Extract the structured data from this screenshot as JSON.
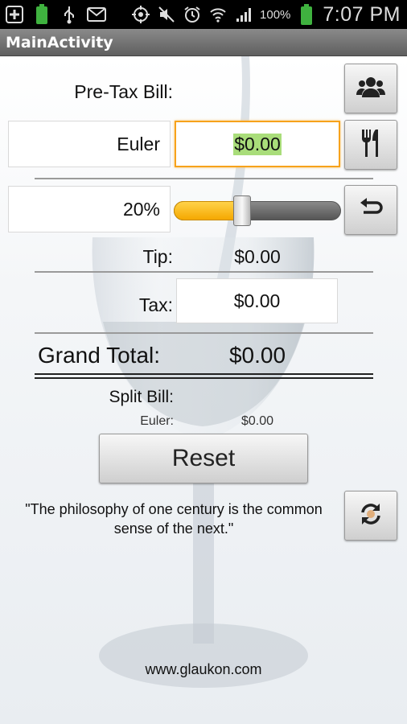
{
  "status_bar": {
    "battery": "100%",
    "time": "7:07 PM"
  },
  "title_bar": {
    "title": "MainActivity"
  },
  "form": {
    "pretax_label": "Pre-Tax Bill:",
    "person_name": "Euler",
    "pretax_value": "$0.00",
    "tip_percent_label": "20%",
    "tip_percent": 20,
    "tip_label": "Tip:",
    "tip_value": "$0.00",
    "tax_label": "Tax:",
    "tax_value": "$0.00",
    "grand_total_label": "Grand Total:",
    "grand_total_value": "$0.00",
    "split_label": "Split Bill:",
    "split_name": "Euler:",
    "split_value": "$0.00",
    "reset_label": "Reset"
  },
  "quote": "\"The philosophy of one century is the common sense of the next.\"",
  "footer": "www.glaukon.com",
  "icons": {
    "people": "people-icon",
    "utensils": "fork-knife-icon",
    "undo": "undo-arrow-icon",
    "refresh": "refresh-icon"
  },
  "colors": {
    "accent": "#f7a21b",
    "slider_fill": "#f5a800",
    "highlight": "#a9dd7a"
  }
}
